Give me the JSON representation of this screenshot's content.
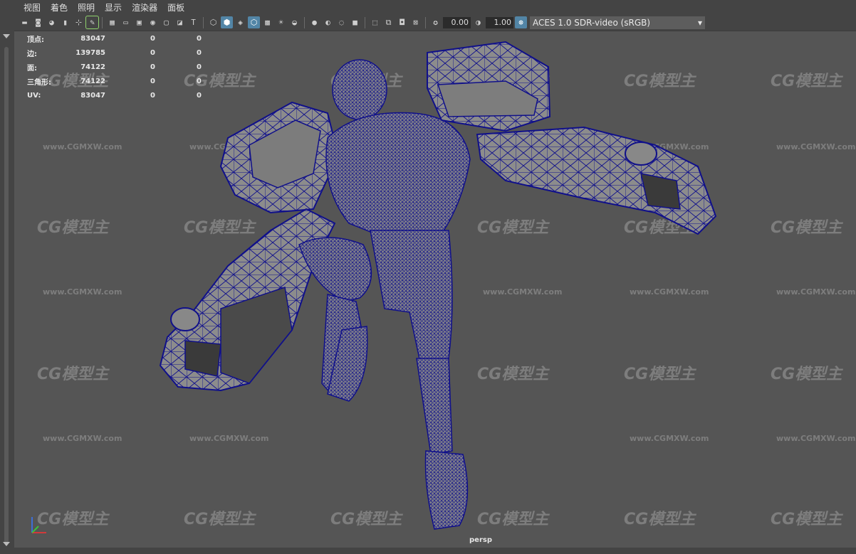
{
  "menubar": {
    "items": [
      {
        "label": "视图"
      },
      {
        "label": "着色"
      },
      {
        "label": "照明"
      },
      {
        "label": "显示"
      },
      {
        "label": "渲染器"
      },
      {
        "label": "面板"
      }
    ]
  },
  "toolbar": {
    "exposure_value": "0.00",
    "gamma_value": "1.00",
    "colorspace_selected": "ACES 1.0 SDR-video (sRGB)",
    "icons": [
      "camera-select-icon",
      "camera-attributes-icon",
      "bookmark-icon",
      "image-plane-icon",
      "grid-icon",
      "film-gate-icon",
      "resolution-gate-icon",
      "gate-mask-icon",
      "field-chart-icon",
      "safe-action-icon",
      "safe-title-icon",
      "wireframe-icon",
      "smooth-shade-icon",
      "flat-shade-icon",
      "wireframe-on-shaded-icon",
      "textures-icon",
      "lights-icon",
      "shadows-icon",
      "ambient-occlusion-icon",
      "motion-blur-icon",
      "anti-aliasing-icon",
      "depth-of-field-icon",
      "select-icon",
      "isolate-icon",
      "xray-icon",
      "xray-joints-icon",
      "exposure-icon",
      "gamma-icon",
      "color-management-icon"
    ]
  },
  "hud": {
    "rows": [
      {
        "label": "顶点:",
        "v1": "83047",
        "v2": "0",
        "v3": "0"
      },
      {
        "label": "边:",
        "v1": "139785",
        "v2": "0",
        "v3": "0"
      },
      {
        "label": "面:",
        "v1": "74122",
        "v2": "0",
        "v3": "0"
      },
      {
        "label": "三角形:",
        "v1": "74122",
        "v2": "0",
        "v3": "0"
      },
      {
        "label": "UV:",
        "v1": "83047",
        "v2": "0",
        "v3": "0"
      }
    ]
  },
  "viewport": {
    "camera_label": "persp",
    "watermark_big": "CG模型主",
    "watermark_small": "www.CGMXW.com"
  },
  "colors": {
    "wireframe": "#10108a",
    "model_fill": "#8c8c8c",
    "viewport_bg": "#555555",
    "active_icon": "#5285a6"
  }
}
